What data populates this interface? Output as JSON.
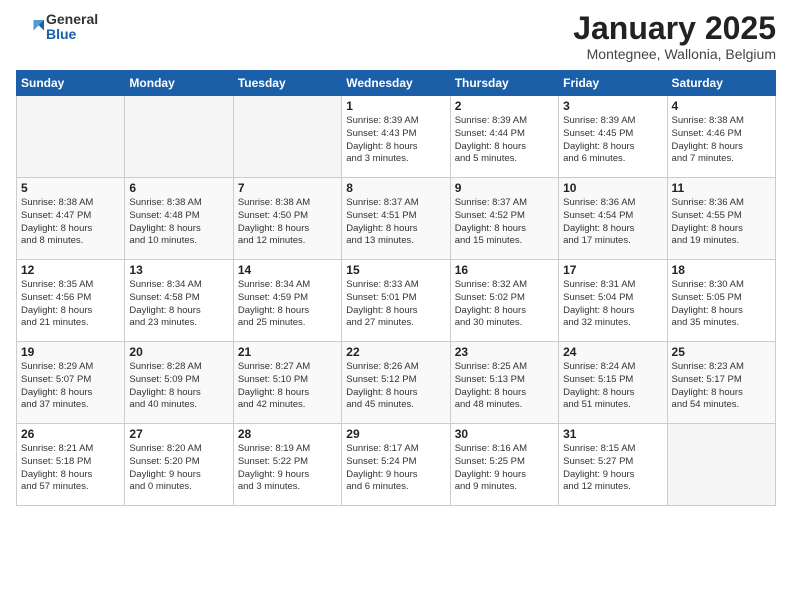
{
  "logo": {
    "general": "General",
    "blue": "Blue"
  },
  "title": "January 2025",
  "subtitle": "Montegnee, Wallonia, Belgium",
  "weekdays": [
    "Sunday",
    "Monday",
    "Tuesday",
    "Wednesday",
    "Thursday",
    "Friday",
    "Saturday"
  ],
  "weeks": [
    [
      {
        "day": "",
        "info": ""
      },
      {
        "day": "",
        "info": ""
      },
      {
        "day": "",
        "info": ""
      },
      {
        "day": "1",
        "info": "Sunrise: 8:39 AM\nSunset: 4:43 PM\nDaylight: 8 hours\nand 3 minutes."
      },
      {
        "day": "2",
        "info": "Sunrise: 8:39 AM\nSunset: 4:44 PM\nDaylight: 8 hours\nand 5 minutes."
      },
      {
        "day": "3",
        "info": "Sunrise: 8:39 AM\nSunset: 4:45 PM\nDaylight: 8 hours\nand 6 minutes."
      },
      {
        "day": "4",
        "info": "Sunrise: 8:38 AM\nSunset: 4:46 PM\nDaylight: 8 hours\nand 7 minutes."
      }
    ],
    [
      {
        "day": "5",
        "info": "Sunrise: 8:38 AM\nSunset: 4:47 PM\nDaylight: 8 hours\nand 8 minutes."
      },
      {
        "day": "6",
        "info": "Sunrise: 8:38 AM\nSunset: 4:48 PM\nDaylight: 8 hours\nand 10 minutes."
      },
      {
        "day": "7",
        "info": "Sunrise: 8:38 AM\nSunset: 4:50 PM\nDaylight: 8 hours\nand 12 minutes."
      },
      {
        "day": "8",
        "info": "Sunrise: 8:37 AM\nSunset: 4:51 PM\nDaylight: 8 hours\nand 13 minutes."
      },
      {
        "day": "9",
        "info": "Sunrise: 8:37 AM\nSunset: 4:52 PM\nDaylight: 8 hours\nand 15 minutes."
      },
      {
        "day": "10",
        "info": "Sunrise: 8:36 AM\nSunset: 4:54 PM\nDaylight: 8 hours\nand 17 minutes."
      },
      {
        "day": "11",
        "info": "Sunrise: 8:36 AM\nSunset: 4:55 PM\nDaylight: 8 hours\nand 19 minutes."
      }
    ],
    [
      {
        "day": "12",
        "info": "Sunrise: 8:35 AM\nSunset: 4:56 PM\nDaylight: 8 hours\nand 21 minutes."
      },
      {
        "day": "13",
        "info": "Sunrise: 8:34 AM\nSunset: 4:58 PM\nDaylight: 8 hours\nand 23 minutes."
      },
      {
        "day": "14",
        "info": "Sunrise: 8:34 AM\nSunset: 4:59 PM\nDaylight: 8 hours\nand 25 minutes."
      },
      {
        "day": "15",
        "info": "Sunrise: 8:33 AM\nSunset: 5:01 PM\nDaylight: 8 hours\nand 27 minutes."
      },
      {
        "day": "16",
        "info": "Sunrise: 8:32 AM\nSunset: 5:02 PM\nDaylight: 8 hours\nand 30 minutes."
      },
      {
        "day": "17",
        "info": "Sunrise: 8:31 AM\nSunset: 5:04 PM\nDaylight: 8 hours\nand 32 minutes."
      },
      {
        "day": "18",
        "info": "Sunrise: 8:30 AM\nSunset: 5:05 PM\nDaylight: 8 hours\nand 35 minutes."
      }
    ],
    [
      {
        "day": "19",
        "info": "Sunrise: 8:29 AM\nSunset: 5:07 PM\nDaylight: 8 hours\nand 37 minutes."
      },
      {
        "day": "20",
        "info": "Sunrise: 8:28 AM\nSunset: 5:09 PM\nDaylight: 8 hours\nand 40 minutes."
      },
      {
        "day": "21",
        "info": "Sunrise: 8:27 AM\nSunset: 5:10 PM\nDaylight: 8 hours\nand 42 minutes."
      },
      {
        "day": "22",
        "info": "Sunrise: 8:26 AM\nSunset: 5:12 PM\nDaylight: 8 hours\nand 45 minutes."
      },
      {
        "day": "23",
        "info": "Sunrise: 8:25 AM\nSunset: 5:13 PM\nDaylight: 8 hours\nand 48 minutes."
      },
      {
        "day": "24",
        "info": "Sunrise: 8:24 AM\nSunset: 5:15 PM\nDaylight: 8 hours\nand 51 minutes."
      },
      {
        "day": "25",
        "info": "Sunrise: 8:23 AM\nSunset: 5:17 PM\nDaylight: 8 hours\nand 54 minutes."
      }
    ],
    [
      {
        "day": "26",
        "info": "Sunrise: 8:21 AM\nSunset: 5:18 PM\nDaylight: 8 hours\nand 57 minutes."
      },
      {
        "day": "27",
        "info": "Sunrise: 8:20 AM\nSunset: 5:20 PM\nDaylight: 9 hours\nand 0 minutes."
      },
      {
        "day": "28",
        "info": "Sunrise: 8:19 AM\nSunset: 5:22 PM\nDaylight: 9 hours\nand 3 minutes."
      },
      {
        "day": "29",
        "info": "Sunrise: 8:17 AM\nSunset: 5:24 PM\nDaylight: 9 hours\nand 6 minutes."
      },
      {
        "day": "30",
        "info": "Sunrise: 8:16 AM\nSunset: 5:25 PM\nDaylight: 9 hours\nand 9 minutes."
      },
      {
        "day": "31",
        "info": "Sunrise: 8:15 AM\nSunset: 5:27 PM\nDaylight: 9 hours\nand 12 minutes."
      },
      {
        "day": "",
        "info": ""
      }
    ]
  ]
}
